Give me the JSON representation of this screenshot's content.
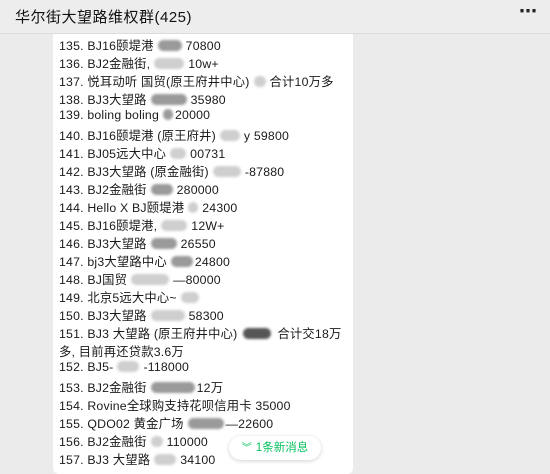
{
  "header": {
    "title": "华尔街大望路维权群(425)",
    "more_icon": "⋯"
  },
  "messages": [
    {
      "a": "135. BJ16颐堤港",
      "b": "70800"
    },
    {
      "a": "136. BJ2金融街,",
      "b": "10w+"
    },
    {
      "a": "137. 悦耳动听 国贸(原王府井中心)",
      "b": "合计10万多"
    },
    {
      "a": "138. BJ3大望路",
      "b": "35980"
    },
    {
      "a": "139. boling boling",
      "b": "20000"
    },
    {
      "a": "140. BJ16颐堤港 (原王府井)",
      "b": "y 59800"
    },
    {
      "a": "141. BJ05远大中心",
      "b": "00731"
    },
    {
      "a": "142. BJ3大望路 (原金融街)",
      "b": "-87880"
    },
    {
      "a": "143. BJ2金融街",
      "b": "280000"
    },
    {
      "a": "144. Hello X BJ颐堤港",
      "b": "24300"
    },
    {
      "a": "145. BJ16颐堤港,",
      "b": "12W+"
    },
    {
      "a": "146. BJ3大望路",
      "b": "26550"
    },
    {
      "a": "147. bj3大望路中心",
      "b": "24800"
    },
    {
      "a": "148. BJ国贸",
      "b": "—80000"
    },
    {
      "a": "149. 北京5远大中心~",
      "b": ""
    },
    {
      "a": "150. BJ3大望路",
      "b": "58300"
    },
    {
      "a": "151. BJ3 大望路 (原王府井中心)",
      "b": "合计交18万"
    },
    {
      "a": "多, 目前再还贷款3.6万",
      "b": ""
    },
    {
      "a": "152. BJ5-",
      "b": "-118000"
    },
    {
      "a": "153. BJ2金融街",
      "b": "12万"
    },
    {
      "a": "154. Rovine全球购支持花呗信用卡 35000",
      "b": ""
    },
    {
      "a": "155. QDO02 黄金广场",
      "b": "—22600"
    },
    {
      "a": "156. BJ2金融街",
      "b": "110000"
    },
    {
      "a": "157. BJ3 大望路",
      "b": "34100"
    }
  ],
  "new_messages": {
    "icon": "chevron-double-down",
    "label": "1条新消息"
  }
}
